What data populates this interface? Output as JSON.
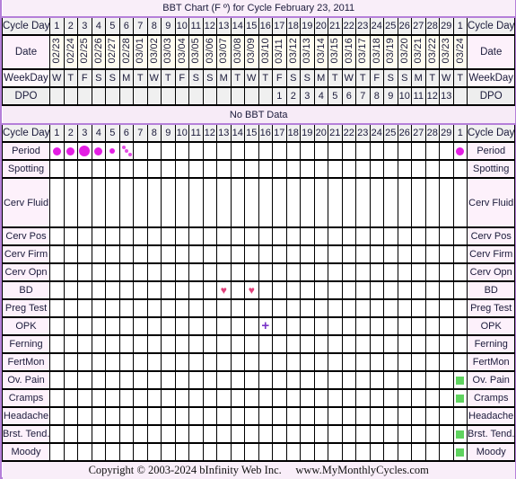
{
  "title": "BBT Chart (F º) for Cycle February 23, 2011",
  "labels": {
    "cycle_day": "Cycle Day",
    "date": "Date",
    "weekday": "WeekDay",
    "dpo": "DPO"
  },
  "cycle_days": [
    "1",
    "2",
    "3",
    "4",
    "5",
    "6",
    "7",
    "8",
    "9",
    "10",
    "11",
    "12",
    "13",
    "14",
    "15",
    "16",
    "17",
    "18",
    "19",
    "20",
    "21",
    "22",
    "23",
    "24",
    "25",
    "26",
    "27",
    "28",
    "29",
    "1"
  ],
  "dates": [
    "02/23",
    "02/24",
    "02/25",
    "02/26",
    "02/27",
    "02/28",
    "03/01",
    "03/02",
    "03/03",
    "03/04",
    "03/05",
    "03/06",
    "03/07",
    "03/08",
    "03/09",
    "03/10",
    "03/11",
    "03/12",
    "03/13",
    "03/14",
    "03/15",
    "03/16",
    "03/17",
    "03/18",
    "03/19",
    "03/20",
    "03/21",
    "03/22",
    "03/23",
    "03/24"
  ],
  "weekdays": [
    "W",
    "T",
    "F",
    "S",
    "S",
    "M",
    "T",
    "W",
    "T",
    "F",
    "S",
    "S",
    "M",
    "T",
    "W",
    "T",
    "F",
    "S",
    "S",
    "M",
    "T",
    "W",
    "T",
    "F",
    "S",
    "S",
    "M",
    "T",
    "W",
    "T"
  ],
  "dpo": [
    "",
    "",
    "",
    "",
    "",
    "",
    "",
    "",
    "",
    "",
    "",
    "",
    "",
    "",
    "",
    "",
    "1",
    "2",
    "3",
    "4",
    "5",
    "6",
    "7",
    "8",
    "9",
    "10",
    "11",
    "12",
    "13",
    ""
  ],
  "no_bbt_text": "No BBT Data",
  "marker_colors": {
    "period": "#e31ee3",
    "heart": "#e0407a",
    "opk_plus": "#7a35c8",
    "symptom": "#5fd35f"
  },
  "rows": [
    {
      "key": "period",
      "label": "Period",
      "tall": false,
      "marks": {
        "0": "period-medium",
        "1": "period-medium",
        "2": "period-heavy",
        "3": "period-medium",
        "4": "period-light",
        "5": "period-spotting",
        "29": "period-medium"
      }
    },
    {
      "key": "spotting",
      "label": "Spotting",
      "tall": false,
      "marks": {}
    },
    {
      "key": "cerv-fluid",
      "label": "Cerv Fluid",
      "tall": true,
      "marks": {}
    },
    {
      "key": "cerv-pos",
      "label": "Cerv Pos",
      "tall": false,
      "marks": {}
    },
    {
      "key": "cerv-firm",
      "label": "Cerv Firm",
      "tall": false,
      "marks": {}
    },
    {
      "key": "cerv-opn",
      "label": "Cerv Opn",
      "tall": false,
      "marks": {}
    },
    {
      "key": "bd",
      "label": "BD",
      "tall": false,
      "marks": {
        "12": "heart",
        "14": "heart"
      }
    },
    {
      "key": "preg-test",
      "label": "Preg Test",
      "tall": false,
      "marks": {}
    },
    {
      "key": "opk",
      "label": "OPK",
      "tall": false,
      "marks": {
        "15": "plus"
      }
    },
    {
      "key": "ferning",
      "label": "Ferning",
      "tall": false,
      "marks": {}
    },
    {
      "key": "fertmon",
      "label": "FertMon",
      "tall": false,
      "marks": {}
    },
    {
      "key": "ov-pain",
      "label": "Ov. Pain",
      "tall": false,
      "marks": {
        "29": "square"
      }
    },
    {
      "key": "cramps",
      "label": "Cramps",
      "tall": false,
      "marks": {
        "29": "square"
      }
    },
    {
      "key": "headache",
      "label": "Headache",
      "tall": false,
      "marks": {}
    },
    {
      "key": "brst-tend",
      "label": "Brst. Tend.",
      "tall": false,
      "marks": {
        "29": "square"
      }
    },
    {
      "key": "moody",
      "label": "Moody",
      "tall": false,
      "marks": {
        "29": "square"
      }
    }
  ],
  "footer": "Copyright © 2003-2024 bInfinity Web Inc.     www.MyMonthlyCycles.com"
}
